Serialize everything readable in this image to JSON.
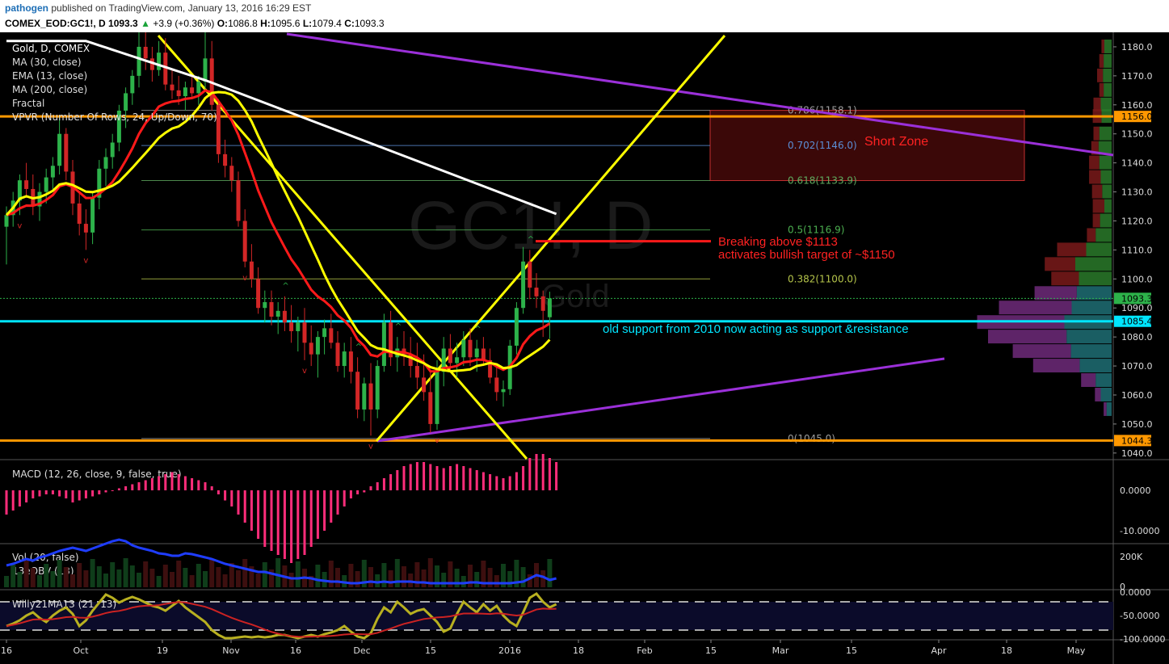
{
  "header": {
    "user": "pathogen",
    "published": "published on TradingView.com, January 13, 2016 16:29 EST",
    "symbol": "COMEX_EOD:GC1!, D",
    "last": "1093.3",
    "up_arrow": "▲",
    "change": "+3.9 (+0.36%)",
    "o_label": "O:",
    "o": "1086.8",
    "h_label": "H:",
    "h": "1095.6",
    "l_label": "L:",
    "l": "1079.4",
    "c_label": "C:",
    "c": "1093.3"
  },
  "legend": {
    "title": "Gold, D, COMEX",
    "items": [
      "MA (30, close)",
      "EMA (13, close)",
      "MA (200, close)",
      "Fractal",
      "VPVR (Number Of Rows, 24, Up/Down, 70)"
    ]
  },
  "watermark": {
    "big": "GC1!, D",
    "small": "Gold"
  },
  "colors": {
    "up": "#2db24a",
    "down": "#d22626",
    "ma30": "#ffff00",
    "ema13": "#ff1a1a",
    "ma200": "#ffffff",
    "orange": "#ff9800",
    "purple": "#9b30d9",
    "cyan": "#00e5ff",
    "macd": "#ff2d7a",
    "obv": "#1f3dff",
    "willy": "#b8b020",
    "willyma": "#cc2222"
  },
  "annotations": {
    "short_zone": "Short Zone",
    "breakout_line1": "Breaking above $1113",
    "breakout_line2": "activates bullish target of ~$1150",
    "support_note": "old support from 2010 now acting as support &resistance"
  },
  "fib_levels": [
    {
      "label": "0.786(1158.1)",
      "price": 1158.1,
      "color": "#9e9e9e"
    },
    {
      "label": "0.702(1146.0)",
      "price": 1146.0,
      "color": "#5b8ed6"
    },
    {
      "label": "0.618(1133.9)",
      "price": 1133.9,
      "color": "#5faa5f"
    },
    {
      "label": "0.5(1116.9)",
      "price": 1116.9,
      "color": "#4caf50"
    },
    {
      "label": "0.382(1100.0)",
      "price": 1100.0,
      "color": "#b5c44a"
    },
    {
      "label": "0(1045.0)",
      "price": 1045.0,
      "color": "#9e9e9e"
    }
  ],
  "price_badges": [
    {
      "label": "1156.0",
      "price": 1156.0,
      "bg": "#ff9800",
      "fg": "#000"
    },
    {
      "label": "1093.3",
      "price": 1093.3,
      "bg": "#2db24a",
      "fg": "#000"
    },
    {
      "label": "1085.4",
      "price": 1085.4,
      "bg": "#00e5ff",
      "fg": "#000"
    },
    {
      "label": "1044.3",
      "price": 1044.3,
      "bg": "#ff9800",
      "fg": "#000"
    }
  ],
  "horizontal_lines": [
    {
      "price": 1156.0,
      "color": "#ff9800"
    },
    {
      "price": 1044.3,
      "color": "#ff9800"
    },
    {
      "price": 1085.4,
      "color": "#00e5ff"
    }
  ],
  "price_axis": {
    "ticks": [
      1180,
      1170,
      1160,
      1150,
      1140,
      1130,
      1120,
      1110,
      1100,
      1090,
      1080,
      1070,
      1060,
      1050,
      1040
    ]
  },
  "time_axis": {
    "labels": [
      "16",
      "Oct",
      "19",
      "Nov",
      "16",
      "Dec",
      "15",
      "2016",
      "18",
      "Feb",
      "15",
      "Mar",
      "15",
      "Apr",
      "18",
      "May"
    ]
  },
  "macd_panel": {
    "title": "MACD (12, 26, close, 9, false, true)",
    "ticks": [
      "0.0000",
      "-10.0000"
    ]
  },
  "vol_panel": {
    "title": "Vol (20, false)",
    "title2": "13eOBV (13)",
    "ticks": [
      "200K",
      "0"
    ]
  },
  "willy_panel": {
    "title": "Willy21MA13 (21, 13)",
    "ticks": [
      "0.0000",
      "-50.0000",
      "-100.0000"
    ]
  },
  "chart_data": {
    "type": "candlestick",
    "series_name": "Gold, D, COMEX",
    "ylim": [
      1038,
      1185
    ],
    "candles": [
      [
        1118,
        1125,
        1105,
        1122
      ],
      [
        1122,
        1130,
        1118,
        1127
      ],
      [
        1127,
        1136,
        1122,
        1134
      ],
      [
        1134,
        1140,
        1128,
        1131
      ],
      [
        1131,
        1136,
        1122,
        1125
      ],
      [
        1125,
        1133,
        1120,
        1130
      ],
      [
        1130,
        1138,
        1126,
        1135
      ],
      [
        1135,
        1142,
        1130,
        1139
      ],
      [
        1139,
        1156,
        1136,
        1150
      ],
      [
        1150,
        1152,
        1134,
        1137
      ],
      [
        1137,
        1141,
        1122,
        1126
      ],
      [
        1126,
        1130,
        1115,
        1119
      ],
      [
        1119,
        1124,
        1110,
        1116
      ],
      [
        1116,
        1130,
        1112,
        1128
      ],
      [
        1128,
        1141,
        1124,
        1138
      ],
      [
        1138,
        1145,
        1132,
        1142
      ],
      [
        1142,
        1150,
        1138,
        1147
      ],
      [
        1147,
        1160,
        1144,
        1158
      ],
      [
        1158,
        1166,
        1152,
        1164
      ],
      [
        1164,
        1172,
        1160,
        1170
      ],
      [
        1170,
        1186,
        1166,
        1180
      ],
      [
        1180,
        1185,
        1172,
        1176
      ],
      [
        1176,
        1180,
        1168,
        1172
      ],
      [
        1172,
        1182,
        1170,
        1178
      ],
      [
        1178,
        1183,
        1165,
        1167
      ],
      [
        1167,
        1172,
        1162,
        1165
      ],
      [
        1165,
        1170,
        1160,
        1163
      ],
      [
        1163,
        1168,
        1158,
        1166
      ],
      [
        1166,
        1170,
        1162,
        1164
      ],
      [
        1164,
        1170,
        1160,
        1168
      ],
      [
        1168,
        1186,
        1165,
        1176
      ],
      [
        1176,
        1182,
        1158,
        1160
      ],
      [
        1160,
        1162,
        1140,
        1143
      ],
      [
        1143,
        1148,
        1135,
        1139
      ],
      [
        1139,
        1142,
        1130,
        1134
      ],
      [
        1134,
        1137,
        1118,
        1120
      ],
      [
        1120,
        1124,
        1104,
        1106
      ],
      [
        1106,
        1112,
        1097,
        1100
      ],
      [
        1100,
        1104,
        1088,
        1090
      ],
      [
        1090,
        1096,
        1085,
        1092
      ],
      [
        1092,
        1096,
        1084,
        1087
      ],
      [
        1087,
        1092,
        1081,
        1089
      ],
      [
        1089,
        1094,
        1082,
        1085
      ],
      [
        1085,
        1091,
        1078,
        1082
      ],
      [
        1082,
        1087,
        1075,
        1085
      ],
      [
        1085,
        1090,
        1072,
        1078
      ],
      [
        1078,
        1084,
        1070,
        1074
      ],
      [
        1074,
        1082,
        1066,
        1080
      ],
      [
        1080,
        1086,
        1074,
        1083
      ],
      [
        1083,
        1088,
        1076,
        1078
      ],
      [
        1078,
        1082,
        1068,
        1070
      ],
      [
        1070,
        1078,
        1066,
        1075
      ],
      [
        1075,
        1080,
        1064,
        1068
      ],
      [
        1068,
        1073,
        1052,
        1055
      ],
      [
        1055,
        1066,
        1051,
        1064
      ],
      [
        1064,
        1071,
        1046,
        1055
      ],
      [
        1055,
        1072,
        1052,
        1070
      ],
      [
        1070,
        1088,
        1068,
        1085
      ],
      [
        1085,
        1089,
        1070,
        1073
      ],
      [
        1073,
        1080,
        1068,
        1076
      ],
      [
        1076,
        1082,
        1070,
        1074
      ],
      [
        1074,
        1080,
        1066,
        1070
      ],
      [
        1070,
        1078,
        1062,
        1066
      ],
      [
        1066,
        1074,
        1058,
        1061
      ],
      [
        1061,
        1068,
        1047,
        1050
      ],
      [
        1050,
        1072,
        1048,
        1068
      ],
      [
        1068,
        1080,
        1063,
        1076
      ],
      [
        1076,
        1081,
        1068,
        1071
      ],
      [
        1071,
        1078,
        1066,
        1073
      ],
      [
        1073,
        1082,
        1070,
        1079
      ],
      [
        1079,
        1083,
        1070,
        1073
      ],
      [
        1073,
        1079,
        1068,
        1076
      ],
      [
        1076,
        1080,
        1070,
        1072
      ],
      [
        1072,
        1076,
        1064,
        1066
      ],
      [
        1066,
        1070,
        1058,
        1061
      ],
      [
        1061,
        1065,
        1056,
        1062
      ],
      [
        1062,
        1079,
        1060,
        1077
      ],
      [
        1077,
        1092,
        1074,
        1090
      ],
      [
        1090,
        1111,
        1088,
        1106
      ],
      [
        1106,
        1110,
        1093,
        1097
      ],
      [
        1097,
        1102,
        1090,
        1094
      ],
      [
        1094,
        1096,
        1080,
        1089
      ],
      [
        1086.8,
        1095.6,
        1079.4,
        1093.3
      ]
    ]
  }
}
